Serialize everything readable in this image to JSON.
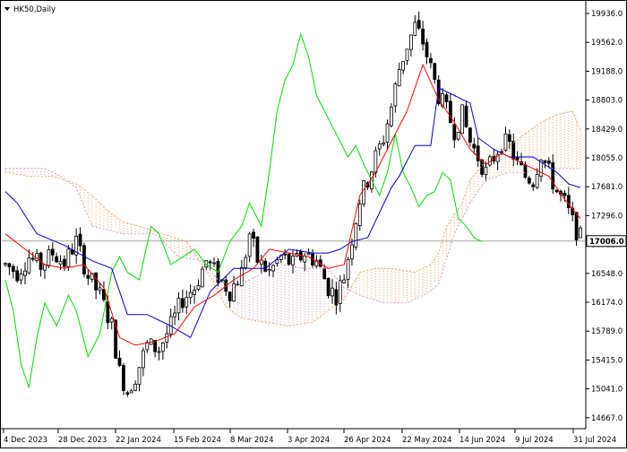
{
  "symbol_label": "HK50,Daily",
  "icons": {
    "symbol_marker": "triangle-down-icon"
  },
  "colors": {
    "background": "#ffffff",
    "candle": "#000000",
    "tenkan": "#ff0000",
    "kijun": "#0000cc",
    "chikou": "#00dd00",
    "cloud_bull": "#f4a460",
    "cloud_bear": "#d8a0c8",
    "current_price_line": "#9aa89a",
    "axis": "#000000"
  },
  "chart_data": {
    "type": "candlestick",
    "indicator": "Ichimoku Kinko Hyo",
    "ylim": [
      14587,
      20120
    ],
    "y_ticks": [
      "19936.0",
      "19562.0",
      "19188.0",
      "18803.0",
      "18429.0",
      "18055.0",
      "17681.0",
      "17296.0",
      "16922.0",
      "16548.0",
      "16174.0",
      "15789.0",
      "15415.0",
      "15041.0",
      "14667.0"
    ],
    "x_ticks": [
      "4 Dec 2023",
      "28 Dec 2023",
      "22 Jan 2024",
      "15 Feb 2024",
      "8 Mar 2024",
      "3 Apr 2024",
      "26 Apr 2024",
      "22 May 2024",
      "14 Jun 2024",
      "9 Jul 2024",
      "31 Jul 2024"
    ],
    "current_price": "17006.0",
    "current_price_value": 17006,
    "price_path": [
      [
        0,
        16700
      ],
      [
        3,
        16600
      ],
      [
        6,
        16800
      ],
      [
        9,
        16680
      ],
      [
        12,
        16850
      ],
      [
        15,
        16720
      ],
      [
        18,
        17000
      ],
      [
        21,
        16550
      ],
      [
        24,
        16300
      ],
      [
        27,
        15900
      ],
      [
        29,
        15300
      ],
      [
        31,
        15050
      ],
      [
        33,
        15250
      ],
      [
        36,
        15650
      ],
      [
        39,
        15600
      ],
      [
        42,
        15900
      ],
      [
        45,
        16250
      ],
      [
        48,
        16400
      ],
      [
        51,
        16750
      ],
      [
        54,
        16550
      ],
      [
        57,
        16350
      ],
      [
        60,
        16600
      ],
      [
        62,
        17100
      ],
      [
        64,
        16750
      ],
      [
        67,
        16600
      ],
      [
        70,
        16800
      ],
      [
        73,
        16700
      ],
      [
        76,
        16850
      ],
      [
        79,
        16750
      ],
      [
        82,
        16400
      ],
      [
        84,
        16300
      ],
      [
        86,
        16550
      ],
      [
        88,
        17050
      ],
      [
        90,
        17550
      ],
      [
        92,
        17800
      ],
      [
        94,
        18100
      ],
      [
        96,
        18350
      ],
      [
        98,
        18750
      ],
      [
        100,
        19250
      ],
      [
        102,
        19550
      ],
      [
        104,
        19800
      ],
      [
        106,
        19600
      ],
      [
        108,
        19250
      ],
      [
        110,
        18900
      ],
      [
        112,
        18700
      ],
      [
        114,
        18450
      ],
      [
        116,
        18650
      ],
      [
        118,
        18300
      ],
      [
        120,
        18100
      ],
      [
        122,
        17900
      ],
      [
        124,
        18100
      ],
      [
        126,
        18300
      ],
      [
        128,
        18250
      ],
      [
        130,
        18000
      ],
      [
        132,
        17850
      ],
      [
        134,
        17800
      ],
      [
        136,
        18150
      ],
      [
        138,
        17900
      ],
      [
        140,
        17650
      ],
      [
        142,
        17500
      ],
      [
        144,
        17250
      ],
      [
        146,
        17050
      ]
    ],
    "bars_count": 147,
    "kijun_path": [
      [
        0,
        17650
      ],
      [
        3,
        17500
      ],
      [
        8,
        17100
      ],
      [
        15,
        16950
      ],
      [
        22,
        16750
      ],
      [
        27,
        16650
      ],
      [
        31,
        16050
      ],
      [
        36,
        16050
      ],
      [
        42,
        15900
      ],
      [
        47,
        15750
      ],
      [
        52,
        16350
      ],
      [
        58,
        16650
      ],
      [
        66,
        16650
      ],
      [
        72,
        16900
      ],
      [
        78,
        16850
      ],
      [
        82,
        16850
      ],
      [
        85,
        16900
      ],
      [
        88,
        17000
      ],
      [
        92,
        17050
      ],
      [
        98,
        17700
      ],
      [
        100,
        17850
      ],
      [
        104,
        18250
      ],
      [
        108,
        18250
      ],
      [
        110,
        19000
      ],
      [
        114,
        18900
      ],
      [
        118,
        18800
      ],
      [
        120,
        18350
      ],
      [
        124,
        18200
      ],
      [
        128,
        18100
      ],
      [
        131,
        18100
      ],
      [
        134,
        18100
      ],
      [
        137,
        18000
      ],
      [
        140,
        17900
      ],
      [
        143,
        17750
      ],
      [
        146,
        17700
      ]
    ],
    "tenkan_path": [
      [
        0,
        17100
      ],
      [
        5,
        16900
      ],
      [
        10,
        16700
      ],
      [
        15,
        16650
      ],
      [
        20,
        16700
      ],
      [
        25,
        16400
      ],
      [
        29,
        15750
      ],
      [
        33,
        15650
      ],
      [
        38,
        15700
      ],
      [
        43,
        15800
      ],
      [
        48,
        16150
      ],
      [
        53,
        16300
      ],
      [
        58,
        16500
      ],
      [
        63,
        16650
      ],
      [
        67,
        16900
      ],
      [
        72,
        16850
      ],
      [
        77,
        16800
      ],
      [
        82,
        16650
      ],
      [
        86,
        16700
      ],
      [
        90,
        17600
      ],
      [
        94,
        17900
      ],
      [
        98,
        18300
      ],
      [
        102,
        18700
      ],
      [
        106,
        19300
      ],
      [
        110,
        18850
      ],
      [
        114,
        18550
      ],
      [
        118,
        18200
      ],
      [
        122,
        18000
      ],
      [
        126,
        18150
      ],
      [
        130,
        18050
      ],
      [
        134,
        17950
      ],
      [
        138,
        17850
      ],
      [
        142,
        17550
      ],
      [
        146,
        17300
      ]
    ],
    "chikou_path": [
      [
        0,
        16500
      ],
      [
        2,
        16100
      ],
      [
        4,
        15400
      ],
      [
        6,
        15100
      ],
      [
        8,
        15750
      ],
      [
        10,
        16200
      ],
      [
        13,
        15900
      ],
      [
        16,
        16300
      ],
      [
        18,
        16100
      ],
      [
        21,
        15500
      ],
      [
        24,
        15800
      ],
      [
        27,
        16600
      ],
      [
        29,
        16800
      ],
      [
        31,
        16600
      ],
      [
        34,
        16500
      ],
      [
        37,
        17200
      ],
      [
        39,
        17100
      ],
      [
        42,
        16700
      ],
      [
        45,
        16800
      ],
      [
        48,
        16900
      ],
      [
        51,
        16700
      ],
      [
        54,
        16600
      ],
      [
        57,
        17000
      ],
      [
        60,
        17200
      ],
      [
        62,
        17500
      ],
      [
        65,
        17200
      ],
      [
        67,
        17900
      ],
      [
        69,
        18700
      ],
      [
        71,
        19100
      ],
      [
        73,
        19300
      ],
      [
        75,
        19700
      ],
      [
        77,
        19400
      ],
      [
        79,
        18900
      ],
      [
        81,
        18700
      ],
      [
        83,
        18500
      ],
      [
        85,
        18300
      ],
      [
        87,
        18100
      ],
      [
        89,
        18250
      ],
      [
        91,
        18000
      ],
      [
        93,
        17800
      ],
      [
        95,
        17600
      ],
      [
        97,
        17900
      ],
      [
        99,
        18400
      ],
      [
        101,
        17900
      ],
      [
        103,
        17700
      ],
      [
        105,
        17450
      ],
      [
        107,
        17600
      ],
      [
        109,
        17650
      ],
      [
        111,
        17900
      ],
      [
        113,
        17800
      ],
      [
        115,
        17300
      ],
      [
        117,
        17200
      ],
      [
        119,
        17050
      ],
      [
        121,
        17000
      ]
    ],
    "span_a_path": [
      [
        0,
        17900
      ],
      [
        6,
        17850
      ],
      [
        12,
        17850
      ],
      [
        18,
        17750
      ],
      [
        22,
        17600
      ],
      [
        26,
        17400
      ],
      [
        30,
        17250
      ],
      [
        34,
        17200
      ],
      [
        40,
        17100
      ],
      [
        46,
        17000
      ],
      [
        52,
        16550
      ],
      [
        56,
        16150
      ],
      [
        60,
        16000
      ],
      [
        66,
        15950
      ],
      [
        72,
        15900
      ],
      [
        78,
        15950
      ],
      [
        82,
        16100
      ],
      [
        86,
        16250
      ],
      [
        90,
        16600
      ],
      [
        94,
        16650
      ],
      [
        98,
        16650
      ],
      [
        104,
        16600
      ],
      [
        108,
        16700
      ],
      [
        110,
        16850
      ],
      [
        112,
        17200
      ],
      [
        114,
        17350
      ],
      [
        116,
        17500
      ],
      [
        118,
        17800
      ],
      [
        122,
        18050
      ],
      [
        128,
        18250
      ],
      [
        132,
        18400
      ],
      [
        136,
        18550
      ],
      [
        140,
        18650
      ],
      [
        144,
        18700
      ],
      [
        146,
        18450
      ]
    ],
    "span_b_path": [
      [
        0,
        17950
      ],
      [
        10,
        17950
      ],
      [
        14,
        17850
      ],
      [
        18,
        17700
      ],
      [
        22,
        17200
      ],
      [
        30,
        17100
      ],
      [
        38,
        17100
      ],
      [
        44,
        16800
      ],
      [
        50,
        16750
      ],
      [
        54,
        16500
      ],
      [
        58,
        16400
      ],
      [
        64,
        16550
      ],
      [
        70,
        16700
      ],
      [
        76,
        16650
      ],
      [
        82,
        16650
      ],
      [
        86,
        16400
      ],
      [
        90,
        16300
      ],
      [
        96,
        16200
      ],
      [
        102,
        16200
      ],
      [
        108,
        16350
      ],
      [
        110,
        16450
      ],
      [
        114,
        17100
      ],
      [
        118,
        17500
      ],
      [
        122,
        17800
      ],
      [
        128,
        17900
      ],
      [
        132,
        17900
      ],
      [
        136,
        17950
      ],
      [
        140,
        17950
      ],
      [
        146,
        17950
      ]
    ]
  }
}
